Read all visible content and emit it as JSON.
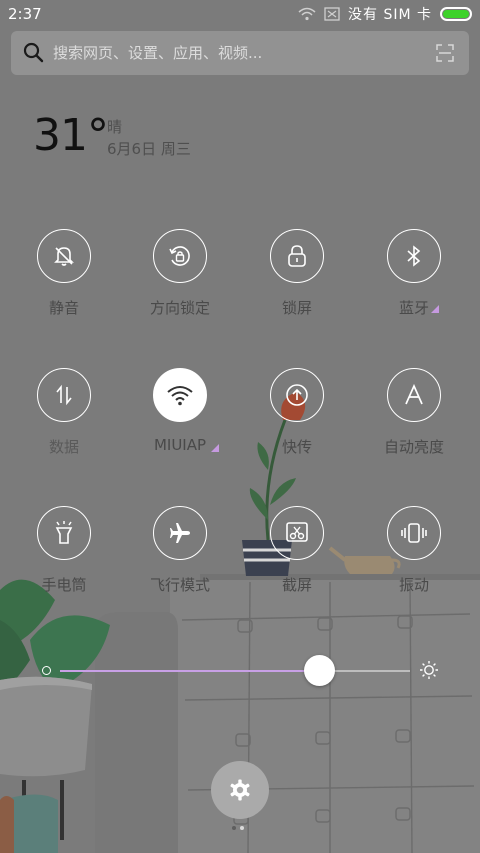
{
  "status_bar": {
    "time": "2:37",
    "carrier": "没有 SIM 卡",
    "battery_color": "#3dd22a",
    "icons": [
      "wifi-icon",
      "no-sim-icon",
      "battery-icon"
    ]
  },
  "search": {
    "placeholder": "搜索网页、设置、应用、视频..."
  },
  "weather": {
    "temperature": "31°",
    "condition": "晴",
    "date": "6月6日 周三"
  },
  "toggles": [
    {
      "label": "静音",
      "icon": "bell-mute-icon",
      "active": false
    },
    {
      "label": "方向锁定",
      "icon": "rotation-lock-icon",
      "active": false
    },
    {
      "label": "锁屏",
      "icon": "lock-icon",
      "active": false
    },
    {
      "label": "蓝牙",
      "icon": "bluetooth-icon",
      "active": false,
      "has_more": true
    },
    {
      "label": "数据",
      "icon": "mobile-data-icon",
      "active": false
    },
    {
      "label": "MIUIAP",
      "icon": "wifi-icon",
      "active": true,
      "has_more": true
    },
    {
      "label": "快传",
      "icon": "upload-icon",
      "active": false
    },
    {
      "label": "自动亮度",
      "icon": "auto-brightness-icon",
      "active": false
    },
    {
      "label": "手电筒",
      "icon": "flashlight-icon",
      "active": false
    },
    {
      "label": "飞行模式",
      "icon": "airplane-icon",
      "active": false
    },
    {
      "label": "截屏",
      "icon": "screenshot-icon",
      "active": false
    },
    {
      "label": "振动",
      "icon": "vibrate-icon",
      "active": false
    }
  ],
  "brightness": {
    "level": 0.74,
    "accent_color": "#c8a0e6"
  },
  "pagination": {
    "pages": 2,
    "current": 1
  },
  "colors": {
    "overlay": "#7b7b7b",
    "active_toggle": "#ffffff",
    "label_text": "#4a4a4a"
  }
}
